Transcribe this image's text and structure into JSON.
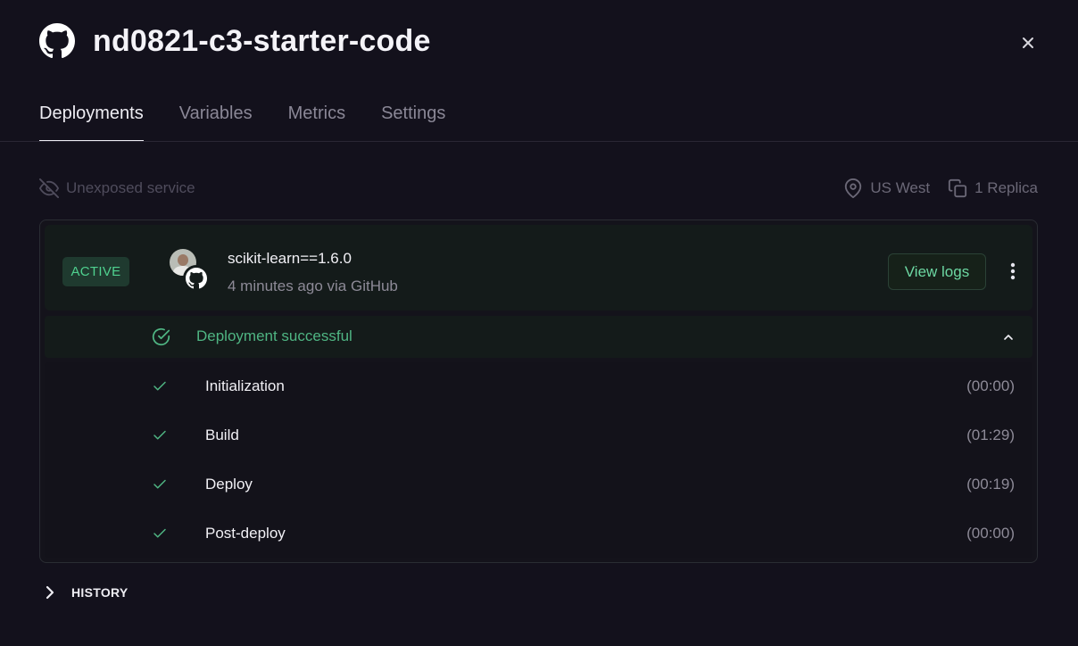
{
  "header": {
    "title": "nd0821-c3-starter-code"
  },
  "tabs": [
    {
      "label": "Deployments",
      "active": true
    },
    {
      "label": "Variables"
    },
    {
      "label": "Metrics"
    },
    {
      "label": "Settings"
    }
  ],
  "service": {
    "exposure": "Unexposed service",
    "region": "US West",
    "replicas": "1 Replica"
  },
  "deployment": {
    "status_badge": "ACTIVE",
    "commit_title": "scikit-learn==1.6.0",
    "commit_sub": "4 minutes ago via GitHub",
    "view_logs_label": "View logs",
    "result": "Deployment successful",
    "steps": [
      {
        "name": "Initialization",
        "duration": "(00:00)"
      },
      {
        "name": "Build",
        "duration": "(01:29)"
      },
      {
        "name": "Deploy",
        "duration": "(00:19)"
      },
      {
        "name": "Post-deploy",
        "duration": "(00:00)"
      }
    ]
  },
  "history": {
    "label": "HISTORY"
  },
  "colors": {
    "accent_green": "#4fd18f",
    "background": "#13111c"
  },
  "icons": [
    "github-icon",
    "close-icon",
    "eye-off-icon",
    "map-pin-icon",
    "copy-icon",
    "check-circle-icon",
    "check-icon",
    "chevron-up-icon",
    "chevron-right-icon",
    "more-vertical-icon"
  ]
}
